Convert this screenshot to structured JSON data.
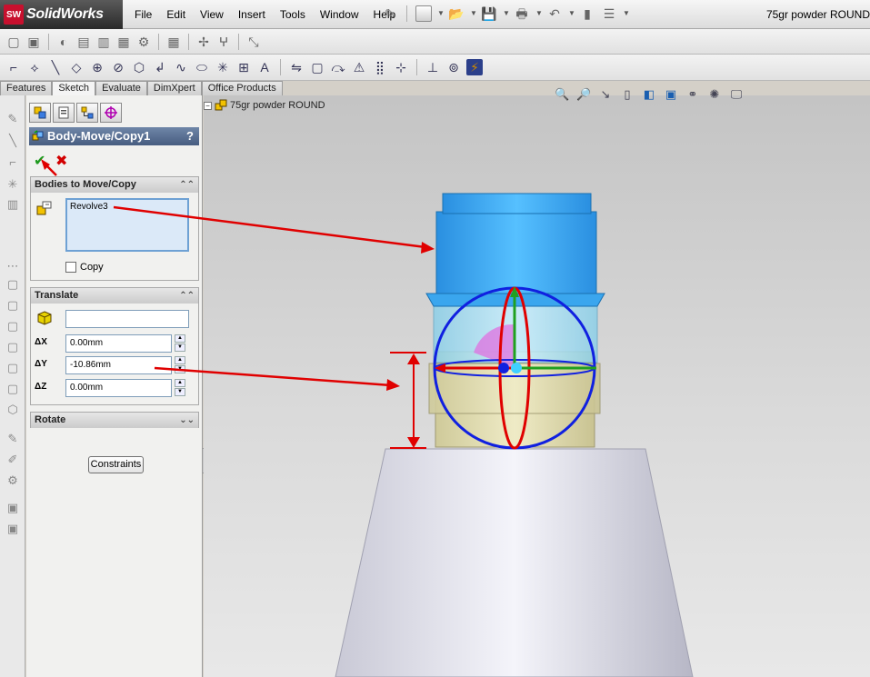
{
  "app": {
    "logo_badge": "SW",
    "name": "SolidWorks",
    "document_title": "75gr powder ROUND"
  },
  "menu": {
    "items": [
      "File",
      "Edit",
      "View",
      "Insert",
      "Tools",
      "Window",
      "Help"
    ]
  },
  "command_tabs": [
    "Features",
    "Sketch",
    "Evaluate",
    "DimXpert",
    "Office Products"
  ],
  "active_tab": "Sketch",
  "property_manager": {
    "title": "Body-Move/Copy1",
    "help": "?",
    "ok_icon": "check-icon",
    "cancel_icon": "x-icon",
    "bodies_group": {
      "title": "Bodies to Move/Copy",
      "selected_body": "Revolve3",
      "copy_label": "Copy",
      "copy_checked": false
    },
    "translate_group": {
      "title": "Translate",
      "entity_value": "",
      "dx_label": "ΔX",
      "dx_value": "0.00mm",
      "dy_label": "ΔY",
      "dy_value": "-10.86mm",
      "dz_label": "ΔZ",
      "dz_value": "0.00mm"
    },
    "rotate_group": {
      "title": "Rotate"
    },
    "constraints_label": "Constraints"
  },
  "feature_tree": {
    "root_label": "75gr powder ROUND"
  },
  "colors": {
    "pm_title_bar": "#475d80",
    "body_blue": "#2aa0f0",
    "annotation_red": "#e00000",
    "triad_green": "#20a020",
    "ok_green": "#1e9a1e"
  }
}
